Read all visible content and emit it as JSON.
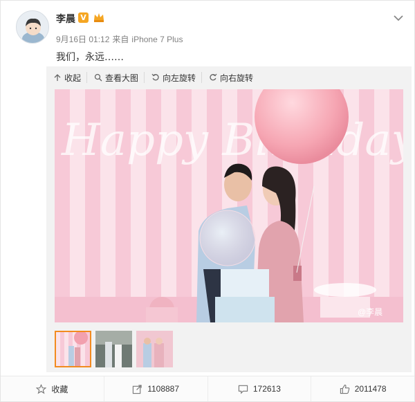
{
  "post": {
    "author": "李晨",
    "badge": "V",
    "meta": {
      "date": "9月16日 01:12",
      "from": "来自",
      "device": "iPhone 7 Plus"
    },
    "text": "我们，永远……"
  },
  "toolbar": {
    "collapse": "收起",
    "view_large": "查看大图",
    "rotate_left": "向左旋转",
    "rotate_right": "向右旋转"
  },
  "image": {
    "watermark": "@李晨",
    "scene_text": "Happy Birthday To BB"
  },
  "actions": {
    "favorite": "收藏",
    "share": "1108887",
    "comment": "172613",
    "like": "2011478"
  },
  "icons": {
    "collapse": "arrow-up-icon",
    "view_large": "magnifier-icon",
    "rotate_left": "rotate-left-icon",
    "rotate_right": "rotate-right-icon",
    "favorite": "star-icon",
    "share": "share-icon",
    "comment": "comment-icon",
    "like": "thumbs-up-icon",
    "menu": "chevron-down-icon"
  },
  "colors": {
    "accent": "#f28b1f",
    "verified": "#f5a623",
    "text_secondary": "#808080"
  }
}
